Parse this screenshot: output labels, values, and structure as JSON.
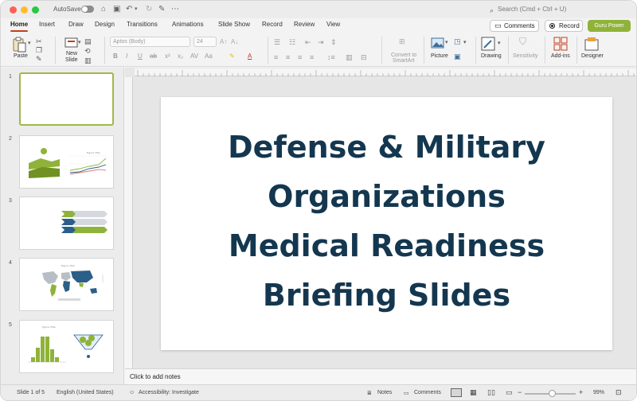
{
  "titlebar": {
    "autosave_label": "AutoSave",
    "search_placeholder": "Search (Cmd + Ctrl + U)"
  },
  "tabs": [
    {
      "label": "Home",
      "active": true
    },
    {
      "label": "Insert"
    },
    {
      "label": "Draw"
    },
    {
      "label": "Design"
    },
    {
      "label": "Transitions"
    },
    {
      "label": "Animations"
    },
    {
      "label": "Slide Show"
    },
    {
      "label": "Record"
    },
    {
      "label": "Review"
    },
    {
      "label": "View"
    }
  ],
  "header_buttons": {
    "comments": "Comments",
    "record": "Record",
    "guru": "Guru Power"
  },
  "ribbon": {
    "paste": "Paste",
    "new_slide_line1": "New",
    "new_slide_line2": "Slide",
    "font_name": "Aptos (Body)",
    "font_size": "24",
    "convert_line1": "Convert to",
    "convert_line2": "SmartArt",
    "picture": "Picture",
    "drawing": "Drawing",
    "sensitivity": "Sensitivity",
    "addins": "Add-ins",
    "designer": "Designer"
  },
  "thumbnails": [
    {
      "number": "1",
      "selected": true
    },
    {
      "number": "2",
      "chart_title": "Figure Title"
    },
    {
      "number": "3"
    },
    {
      "number": "4",
      "map_title": "Figure Title"
    },
    {
      "number": "5",
      "chart_title": "Figure Title"
    }
  ],
  "slide": {
    "title_lines": [
      "Defense & Military",
      "Organizations",
      "Medical Readiness",
      "Briefing Slides"
    ]
  },
  "notes_placeholder": "Click to add notes",
  "statusbar": {
    "slide_counter": "Slide 1 of 5",
    "language": "English (United States)",
    "accessibility": "Accessibility: Investigate",
    "notes": "Notes",
    "comments": "Comments",
    "zoom": "99%"
  },
  "colors": {
    "title_text": "#14374f",
    "accent_green": "#8fb33a",
    "accent_blue": "#2b5f8a",
    "tab_underline": "#c43e1c"
  }
}
